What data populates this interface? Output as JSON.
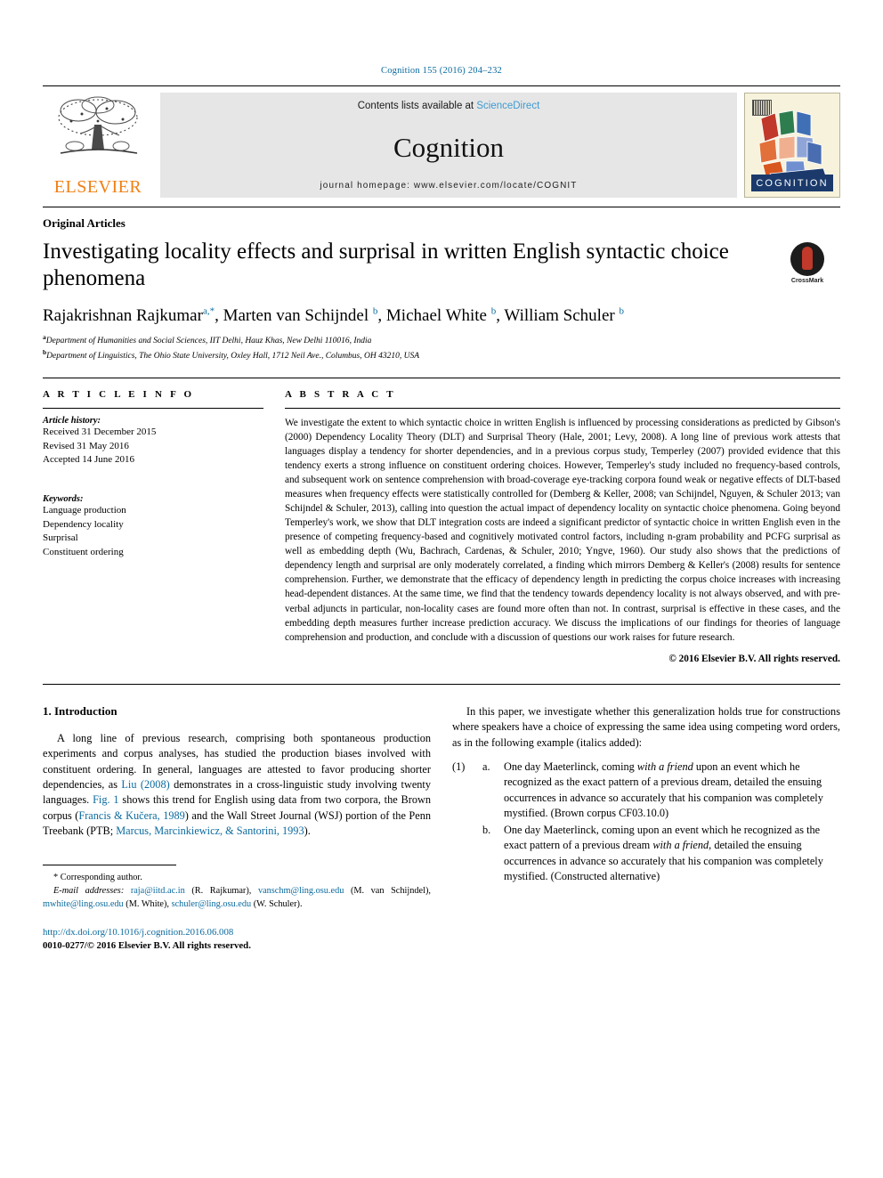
{
  "running_head": "Cognition 155 (2016) 204–232",
  "masthead": {
    "publisher_name": "ELSEVIER",
    "contents_prefix": "Contents lists available at ",
    "contents_link": "ScienceDirect",
    "journal_name": "Cognition",
    "homepage": "journal homepage: www.elsevier.com/locate/COGNIT",
    "cover_label": "COGNITION"
  },
  "article": {
    "kicker": "Original Articles",
    "title": "Investigating locality effects and surprisal in written English syntactic choice phenomena",
    "crossmark_label": "CrossMark",
    "authors": [
      {
        "name": "Rajakrishnan Rajkumar",
        "marks": "a,*"
      },
      {
        "name": "Marten van Schijndel",
        "marks": "b"
      },
      {
        "name": "Michael White",
        "marks": "b"
      },
      {
        "name": "William Schuler",
        "marks": "b"
      }
    ],
    "affiliations": [
      {
        "mark": "a",
        "text": "Department of Humanities and Social Sciences, IIT Delhi, Hauz Khas, New Delhi 110016, India"
      },
      {
        "mark": "b",
        "text": "Department of Linguistics, The Ohio State University, Oxley Hall, 1712 Neil Ave., Columbus, OH 43210, USA"
      }
    ]
  },
  "article_info": {
    "heading": "A R T I C L E   I N F O",
    "history_label": "Article history:",
    "history": [
      "Received 31 December 2015",
      "Revised 31 May 2016",
      "Accepted 14 June 2016"
    ],
    "keywords_label": "Keywords:",
    "keywords": [
      "Language production",
      "Dependency locality",
      "Surprisal",
      "Constituent ordering"
    ]
  },
  "abstract": {
    "heading": "A B S T R A C T",
    "text": "We investigate the extent to which syntactic choice in written English is influenced by processing considerations as predicted by Gibson's (2000) Dependency Locality Theory (DLT) and Surprisal Theory (Hale, 2001; Levy, 2008). A long line of previous work attests that languages display a tendency for shorter dependencies, and in a previous corpus study, Temperley (2007) provided evidence that this tendency exerts a strong influence on constituent ordering choices. However, Temperley's study included no frequency-based controls, and subsequent work on sentence comprehension with broad-coverage eye-tracking corpora found weak or negative effects of DLT-based measures when frequency effects were statistically controlled for (Demberg & Keller, 2008; van Schijndel, Nguyen, & Schuler 2013; van Schijndel & Schuler, 2013), calling into question the actual impact of dependency locality on syntactic choice phenomena. Going beyond Temperley's work, we show that DLT integration costs are indeed a significant predictor of syntactic choice in written English even in the presence of competing frequency-based and cognitively motivated control factors, including n-gram probability and PCFG surprisal as well as embedding depth (Wu, Bachrach, Cardenas, & Schuler, 2010; Yngve, 1960). Our study also shows that the predictions of dependency length and surprisal are only moderately correlated, a finding which mirrors Demberg & Keller's (2008) results for sentence comprehension. Further, we demonstrate that the efficacy of dependency length in predicting the corpus choice increases with increasing head-dependent distances. At the same time, we find that the tendency towards dependency locality is not always observed, and with pre-verbal adjuncts in particular, non-locality cases are found more often than not. In contrast, surprisal is effective in these cases, and the embedding depth measures further increase prediction accuracy. We discuss the implications of our findings for theories of language comprehension and production, and conclude with a discussion of questions our work raises for future research.",
    "copyright": "© 2016 Elsevier B.V. All rights reserved."
  },
  "introduction": {
    "section_title": "1. Introduction",
    "para1_part1": "A long line of previous research, comprising both spontaneous production experiments and corpus analyses, has studied the production biases involved with constituent ordering. In general, languages are attested to favor producing shorter dependencies, as ",
    "para1_link1": "Liu (2008)",
    "para1_part2": " demonstrates in a cross-linguistic study involving twenty languages. ",
    "para1_link2": "Fig. 1",
    "para1_part3": " shows this trend for English using data from two corpora, the Brown corpus (",
    "para1_link3": "Francis & Kučera, 1989",
    "para1_part4": ") and the Wall Street Journal (WSJ) portion of the Penn Treebank (PTB; ",
    "para1_link4": "Marcus, Marcinkiewicz, & Santorini, 1993",
    "para1_part5": ")."
  },
  "right_column": {
    "para1": "In this paper, we investigate whether this generalization holds true for constructions where speakers have a choice of expressing the same idea using competing word orders, as in the following example (italics added):",
    "example": {
      "number": "(1)",
      "items": [
        {
          "letter": "a.",
          "pre": "One day Maeterlinck, coming ",
          "italic": "with a friend",
          "post": " upon an event which he recognized as the exact pattern of a previous dream, detailed the ensuing occurrences in advance so accurately that his companion was completely mystified. (Brown corpus CF03.10.0)"
        },
        {
          "letter": "b.",
          "pre": "One day Maeterlinck, coming upon an event which he recognized as the exact pattern of a previous dream ",
          "italic": "with a friend",
          "post": ", detailed the ensuing occurrences in advance so accurately that his companion was completely mystified. (Constructed alternative)"
        }
      ]
    }
  },
  "footnotes": {
    "corresponding": "* Corresponding author.",
    "email_label": "E-mail addresses:",
    "emails": [
      {
        "address": "raja@iitd.ac.in",
        "owner": "(R. Rajkumar),"
      },
      {
        "address": "vanschm@ling.osu.edu",
        "owner": "(M. van Schijndel),"
      },
      {
        "address": "mwhite@ling.osu.edu",
        "owner": "(M. White),"
      },
      {
        "address": "schuler@ling.osu.edu",
        "owner": "(W. Schuler)."
      }
    ],
    "doi": "http://dx.doi.org/10.1016/j.cognition.2016.06.008",
    "issn": "0010-0277/© 2016 Elsevier B.V. All rights reserved."
  },
  "colors": {
    "link": "#0b6a9e",
    "sciencedirect": "#3d9ad1",
    "elsevier_orange": "#f07f13",
    "band_gray": "#e6e6e6",
    "cover_navy": "#1b3a6b"
  }
}
